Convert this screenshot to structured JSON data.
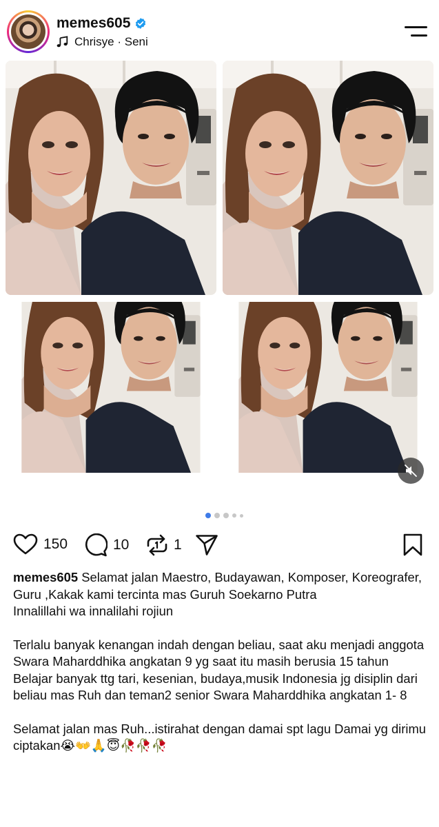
{
  "header": {
    "username": "memes605",
    "verified": true,
    "music_text": "Chrisye · Seni"
  },
  "icons": {
    "avatar": "profile-avatar",
    "verified": "verified-badge-icon",
    "music": "music-note-icon",
    "menu": "menu-icon",
    "like": "heart-icon",
    "comment": "comment-icon",
    "repost": "repost-icon",
    "share": "send-icon",
    "save": "bookmark-icon",
    "mute": "speaker-muted-icon"
  },
  "colors": {
    "accent": "#3f7be8",
    "verified": "#1d9bf0",
    "text": "#111111"
  },
  "carousel": {
    "current_index": 1,
    "dot_count": 5
  },
  "actions": {
    "likes": "150",
    "comments": "10",
    "reposts": "1"
  },
  "caption": {
    "username": "memes605",
    "paragraphs": [
      "Selamat jalan Maestro, Budayawan, Komposer, Koreografer, Guru ,Kakak kami tercinta mas Guruh Soekarno Putra",
      "Innalillahi wa innalilahi rojiun",
      "",
      "Terlalu banyak kenangan indah dengan beliau, saat aku menjadi anggota Swara Maharddhika angkatan 9 yg saat itu masih berusia 15 tahun",
      "Belajar banyak ttg tari, kesenian, budaya,musik Indonesia jg disiplin dari beliau mas Ruh dan teman2 senior Swara Maharddhika angkatan 1- 8",
      "",
      "Selamat jalan mas Ruh...istirahat dengan damai spt lagu Damai yg dirimu ciptakan😭👐🙏😇🥀🥀🥀"
    ]
  }
}
